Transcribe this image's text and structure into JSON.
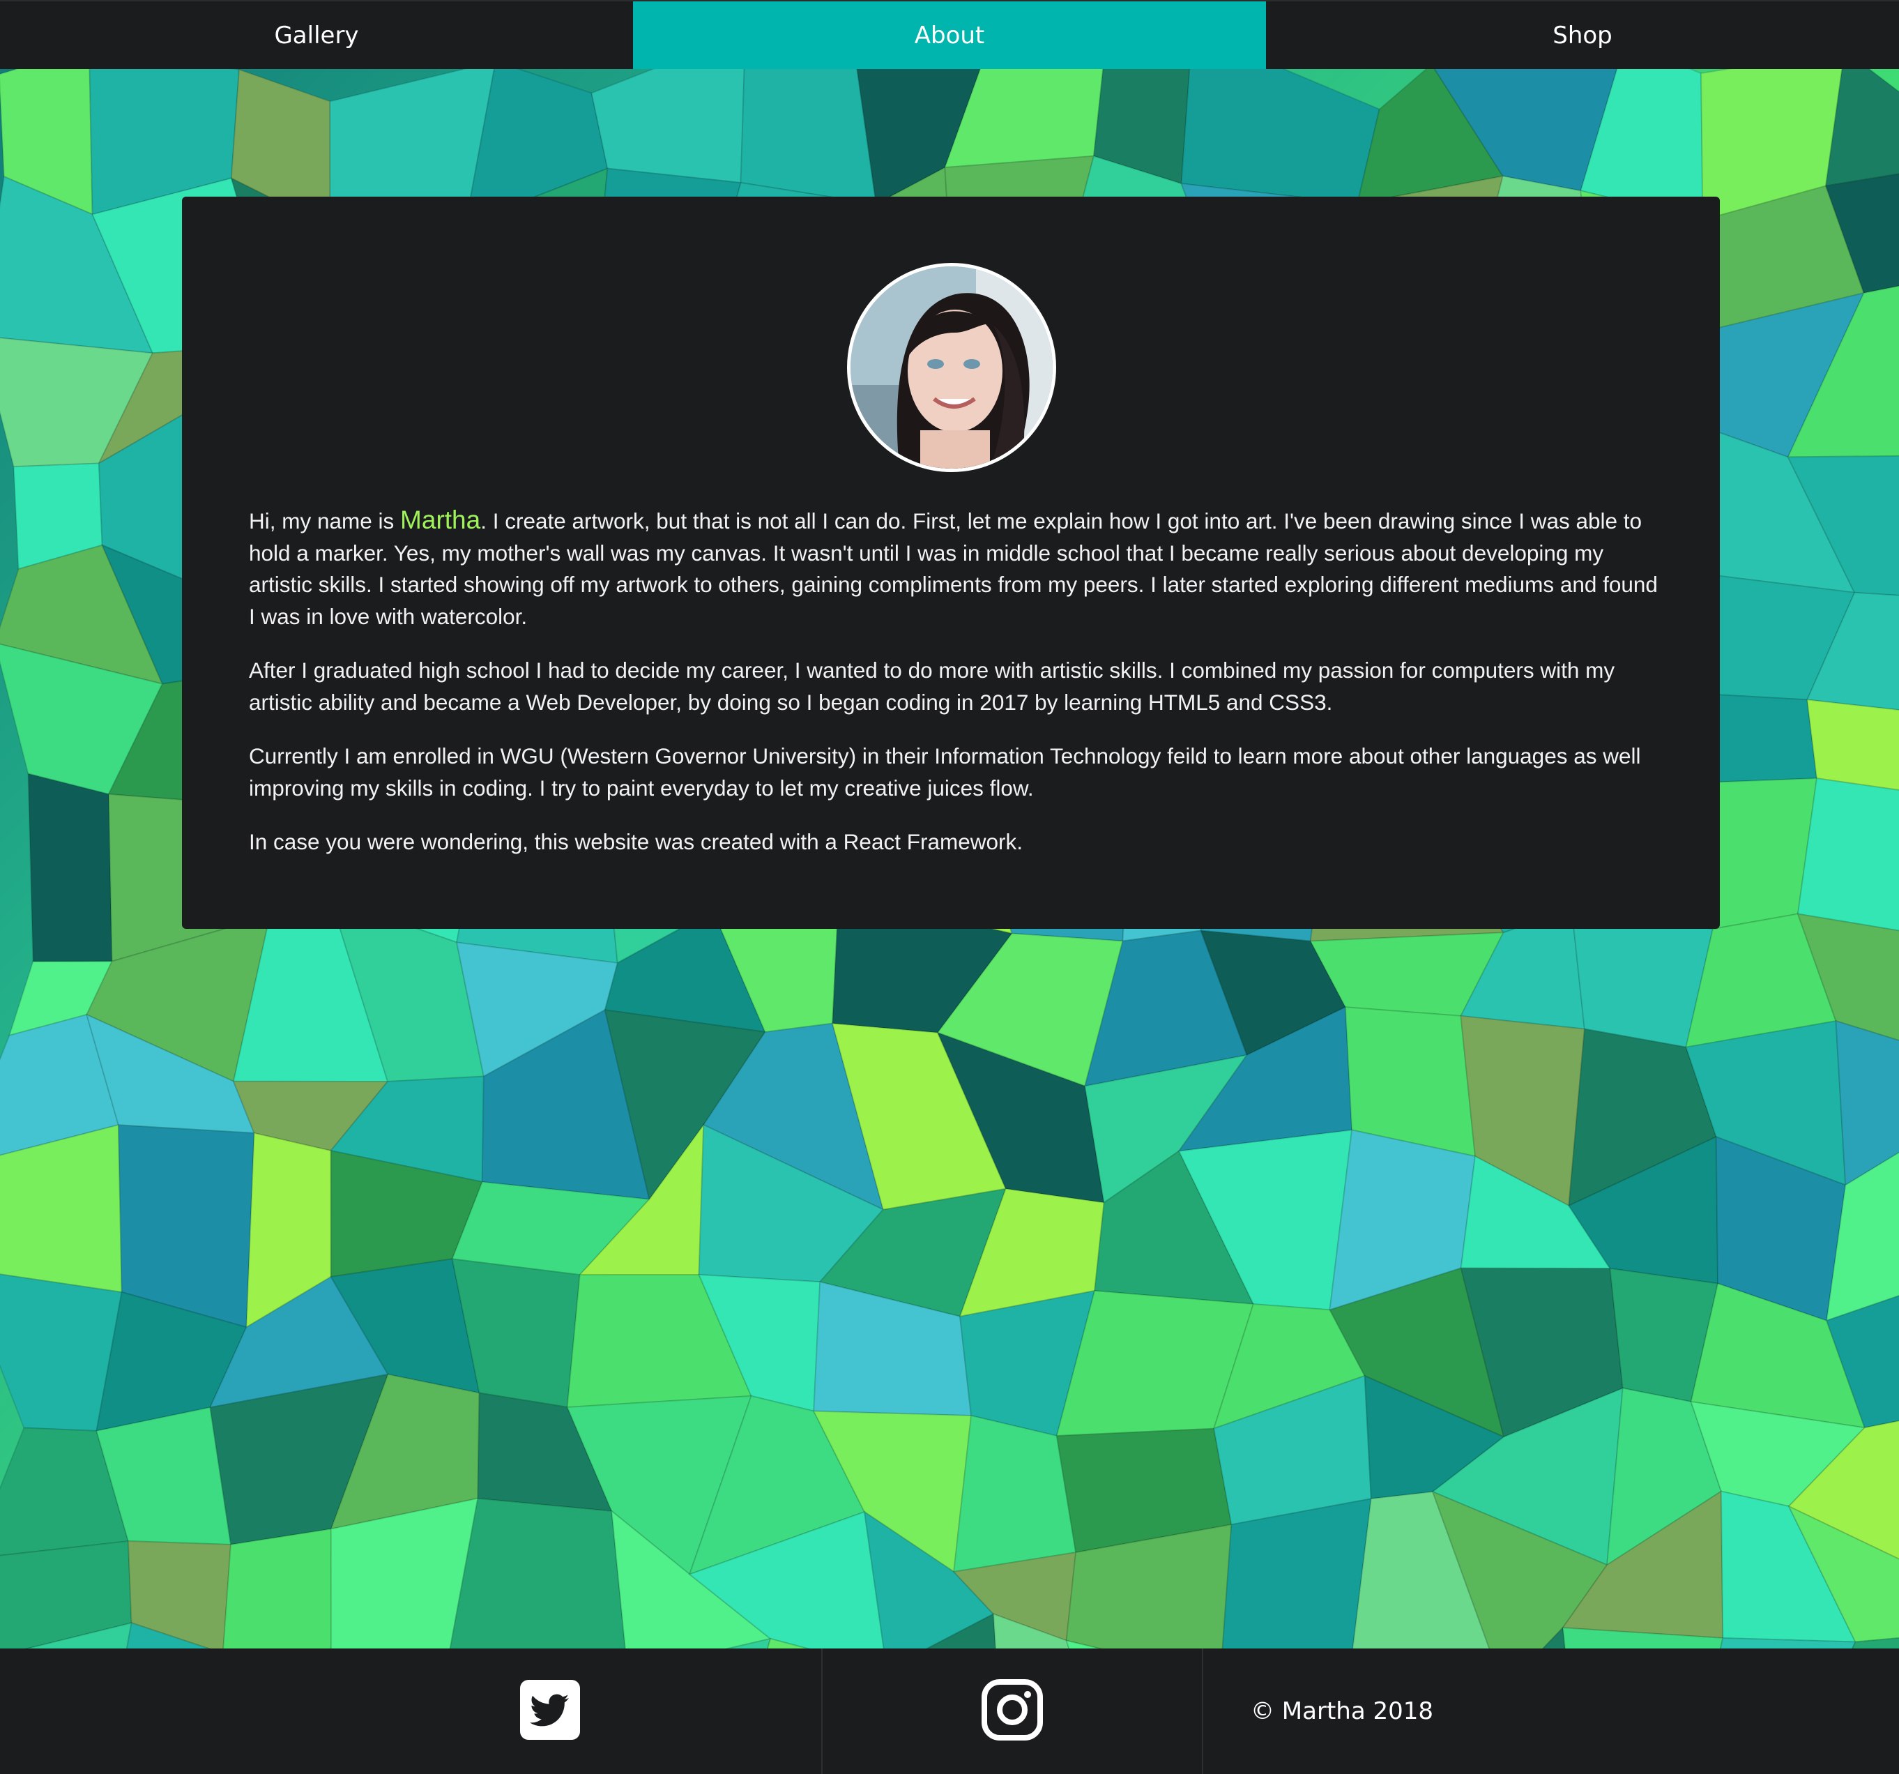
{
  "nav": {
    "tabs": [
      {
        "label": "Gallery",
        "active": false
      },
      {
        "label": "About",
        "active": true
      },
      {
        "label": "Shop",
        "active": false
      }
    ]
  },
  "about": {
    "intro_before": "Hi, my name is ",
    "name": "Martha",
    "intro_after": ". I create artwork, but that is not all I can do. First, let me explain how I got into art. I've been drawing since I was able to hold a marker. Yes, my mother's wall was my canvas. It wasn't until I was in middle school that I became really serious about developing my artistic skills. I started showing off my artwork to others, gaining compliments from my peers. I later started exploring different mediums and found I was in love with watercolor.",
    "paragraph2": "After I graduated high school I had to decide my career, I wanted to do more with artistic skills. I combined my passion for computers with my artistic ability and became a Web Developer, by doing so I began coding in 2017 by learning HTML5 and CSS3.",
    "paragraph3": "Currently I am enrolled in WGU (Western Governor University) in their Information Technology feild to learn more about other languages as well improving my skills in coding. I try to paint everyday to let my creative juices flow.",
    "paragraph4": "In case you were wondering, this website was created with a React Framework."
  },
  "footer": {
    "social": [
      {
        "icon": "twitter-icon"
      },
      {
        "icon": "instagram-icon"
      }
    ],
    "copyright": "© Martha 2018"
  },
  "colors": {
    "accent": "#00b5ad",
    "highlight": "#9ff25a",
    "panel": "#1b1c1e"
  }
}
